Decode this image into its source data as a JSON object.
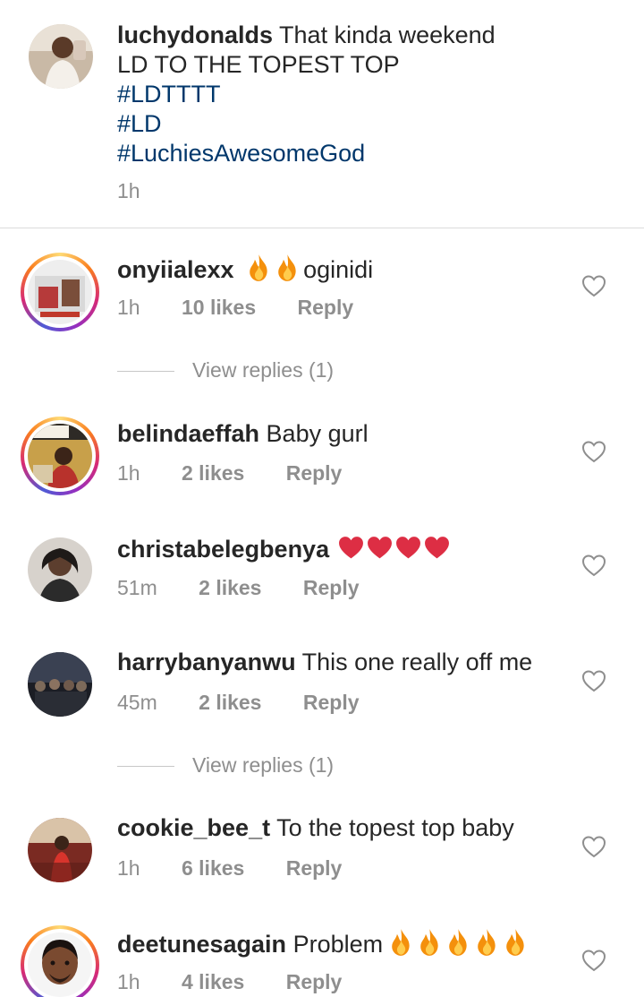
{
  "caption": {
    "username": "luchydonalds",
    "text": "That kinda weekend",
    "line2": "LD TO THE TOPEST TOP",
    "hashtags": [
      "#LDTTTT",
      "#LD",
      "#LuchiesAwesomeGod"
    ],
    "time": "1h"
  },
  "comments": [
    {
      "username": "onyiialexx",
      "text": "oginidi",
      "emoji": [
        "fire-emoji",
        "fire-emoji"
      ],
      "emoji_position": "before",
      "time": "1h",
      "likes": "10 likes",
      "reply": "Reply",
      "view_replies": "View replies (1)",
      "story_ring": true
    },
    {
      "username": "belindaeffah",
      "text": "Baby gurl",
      "emoji": [],
      "time": "1h",
      "likes": "2 likes",
      "reply": "Reply",
      "story_ring": true
    },
    {
      "username": "christabelegbenya",
      "text": "",
      "emoji": [
        "heart-emoji",
        "heart-emoji",
        "heart-emoji",
        "heart-emoji"
      ],
      "emoji_position": "after",
      "time": "51m",
      "likes": "2 likes",
      "reply": "Reply",
      "story_ring": false
    },
    {
      "username": "harrybanyanwu",
      "text": "This one really off me",
      "emoji": [],
      "time": "45m",
      "likes": "2 likes",
      "reply": "Reply",
      "view_replies": "View replies (1)",
      "story_ring": false
    },
    {
      "username": "cookie_bee_t",
      "text": "To the topest top baby",
      "emoji": [],
      "time": "1h",
      "likes": "6 likes",
      "reply": "Reply",
      "story_ring": false
    },
    {
      "username": "deetunesagain",
      "text": "Problem",
      "emoji": [
        "fire-emoji",
        "fire-emoji",
        "fire-emoji",
        "fire-emoji",
        "fire-emoji"
      ],
      "emoji_position": "after",
      "time": "1h",
      "likes": "4 likes",
      "reply": "Reply",
      "story_ring": true
    }
  ],
  "colors": {
    "username": "#262626",
    "hashtag": "#00376b",
    "secondary": "#8e8e8e",
    "divider": "#dbdbdb"
  },
  "icons": {
    "like": "heart-outline-icon"
  }
}
